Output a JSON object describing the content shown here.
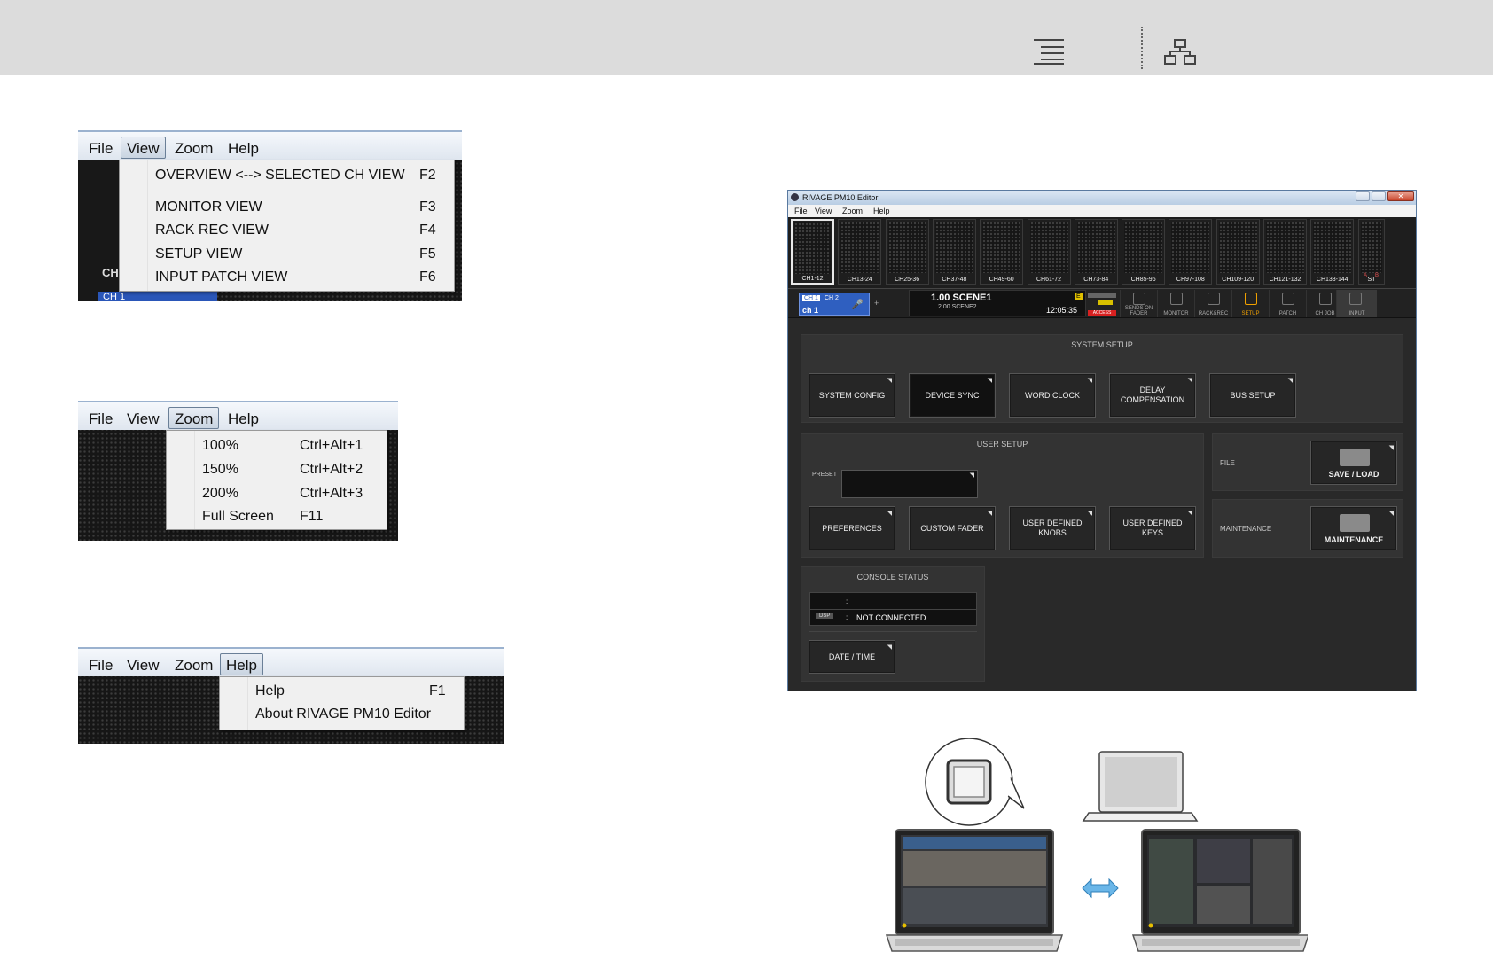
{
  "header": {
    "toc_icon": "table-of-contents-icon",
    "tree_icon": "sitemap-icon"
  },
  "view_menu": {
    "menubar": [
      "File",
      "View",
      "Zoom",
      "Help"
    ],
    "active": "View",
    "items": [
      {
        "label": "OVERVIEW <--> SELECTED CH VIEW",
        "key": "F2"
      },
      {
        "label": "MONITOR VIEW",
        "key": "F3"
      },
      {
        "label": "RACK REC VIEW",
        "key": "F4"
      },
      {
        "label": "SETUP VIEW",
        "key": "F5"
      },
      {
        "label": "INPUT PATCH VIEW",
        "key": "F6"
      }
    ],
    "bg_label_ch": "CH",
    "bg_label_ch1": "CH 1"
  },
  "zoom_menu": {
    "menubar": [
      "File",
      "View",
      "Zoom",
      "Help"
    ],
    "active": "Zoom",
    "items": [
      {
        "label": "100%",
        "key": "Ctrl+Alt+1"
      },
      {
        "label": "150%",
        "key": "Ctrl+Alt+2"
      },
      {
        "label": "200%",
        "key": "Ctrl+Alt+3"
      },
      {
        "label": "Full Screen",
        "key": "F11"
      }
    ]
  },
  "help_menu": {
    "menubar": [
      "File",
      "View",
      "Zoom",
      "Help"
    ],
    "active": "Help",
    "items": [
      {
        "label": "Help",
        "key": "F1"
      },
      {
        "label": "About RIVAGE PM10 Editor",
        "key": ""
      }
    ]
  },
  "app": {
    "title": "RIVAGE PM10 Editor",
    "menubar": [
      "File",
      "View",
      "Zoom",
      "Help"
    ],
    "channel_blocks": [
      "CH1-12",
      "CH13-24",
      "CH25-36",
      "CH37-48",
      "CH49-60",
      "CH61-72",
      "CH73-84",
      "CH85-96",
      "CH97-108",
      "CH109-120",
      "CH121-132",
      "CH133-144"
    ],
    "st_label": "ST",
    "st_ab": [
      "A",
      "B"
    ],
    "ch_selector": {
      "tag": "CH 1",
      "next": "CH 2",
      "name": "ch 1"
    },
    "scene": {
      "current": "1.00 SCENE1",
      "next": "2.00 SCENE2",
      "time": "12:05:35",
      "access": "ACCESS",
      "e_badge": "E"
    },
    "toolbar": [
      {
        "label": "SENDS ON\nFADER",
        "icon": "sends-on-fader-icon",
        "on": false
      },
      {
        "label": "MONITOR",
        "icon": "headphones-icon",
        "on": false
      },
      {
        "label": "RACK&REC",
        "icon": "rack-rec-icon",
        "on": false
      },
      {
        "label": "SETUP",
        "icon": "setup-tools-icon",
        "on": true
      },
      {
        "label": "PATCH",
        "icon": "patch-icon",
        "on": false
      },
      {
        "label": "CH JOB",
        "icon": "ch-job-icon",
        "on": false
      },
      {
        "label": "INPUT",
        "icon": "input-grid-icon",
        "on": false
      }
    ],
    "system_setup": {
      "title": "SYSTEM SETUP",
      "buttons": [
        "SYSTEM CONFIG",
        "DEVICE SYNC",
        "WORD CLOCK",
        "DELAY\nCOMPENSATION",
        "BUS SETUP"
      ]
    },
    "user_setup": {
      "title": "USER SETUP",
      "preset_label": "PRESET",
      "buttons": [
        "PREFERENCES",
        "CUSTOM FADER",
        "USER DEFINED\nKNOBS",
        "USER DEFINED\nKEYS"
      ]
    },
    "file": {
      "label": "FILE",
      "button": "SAVE / LOAD"
    },
    "maintenance": {
      "label": "MAINTENANCE",
      "button": "MAINTENANCE"
    },
    "console_status": {
      "title": "CONSOLE STATUS",
      "row1_sep": ":",
      "dsp_tag": "DSP",
      "row2_sep": ":",
      "status": "NOT CONNECTED",
      "date_button": "DATE / TIME"
    }
  },
  "diagram": {
    "arrow_color": "#6ab6e8"
  }
}
